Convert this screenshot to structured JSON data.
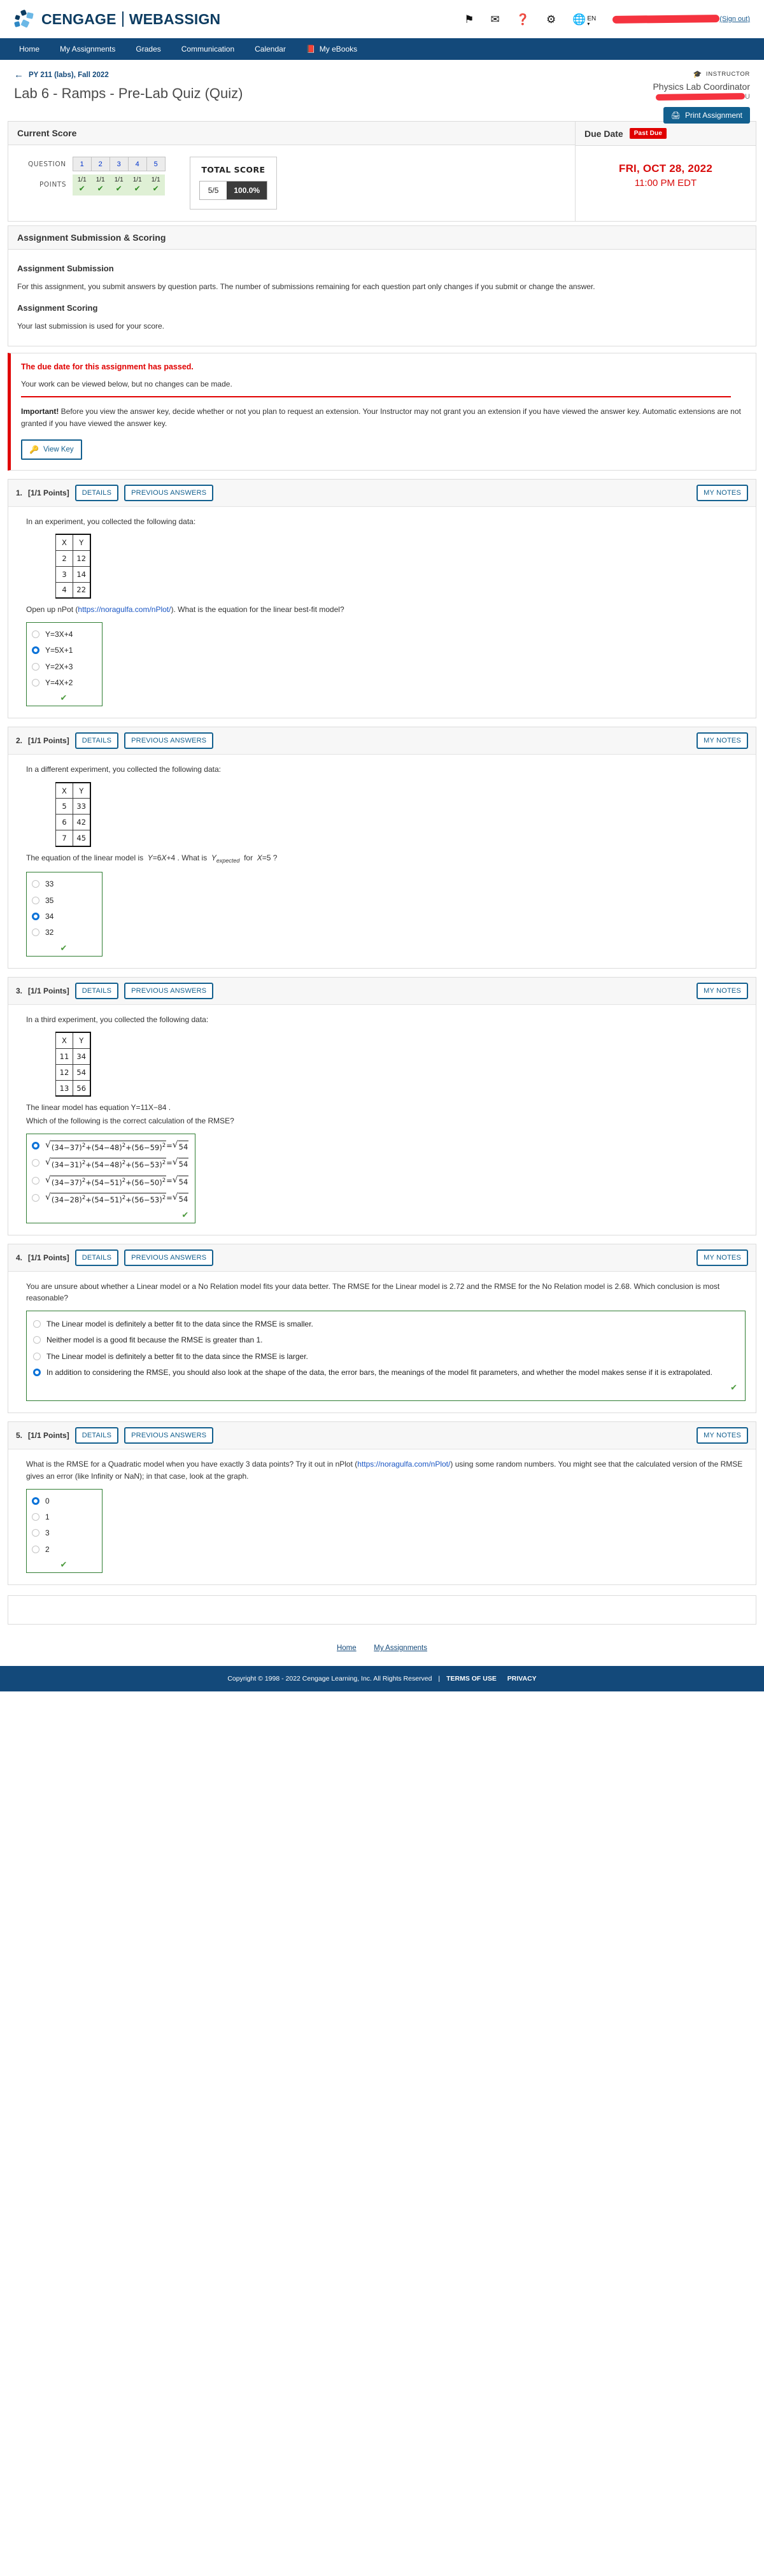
{
  "brand": {
    "name_left": "CENGAGE",
    "name_right": "WEBASSIGN"
  },
  "topbar": {
    "icons": [
      {
        "name": "flag-icon",
        "glyph": "⚑"
      },
      {
        "name": "mail-icon",
        "glyph": "✉"
      },
      {
        "name": "help-icon",
        "glyph": "❓"
      },
      {
        "name": "gear-icon",
        "glyph": "⚙"
      }
    ],
    "language": "EN",
    "signout": "(Sign out)"
  },
  "nav": {
    "items": [
      "Home",
      "My Assignments",
      "Grades",
      "Communication",
      "Calendar"
    ],
    "ebooks": "My eBooks"
  },
  "header": {
    "back_label": "PY 211 (labs), Fall 2022",
    "title": "Lab 6 - Ramps - Pre-Lab Quiz (Quiz)",
    "instructor_tag": "INSTRUCTOR",
    "instructor_name": "Physics Lab Coordinator",
    "instructor_email_suffix": "U",
    "print_button": "Print Assignment"
  },
  "score": {
    "panel_title": "Current Score",
    "question_row_label": "QUESTION",
    "points_row_label": "POINTS",
    "questions": [
      "1",
      "2",
      "3",
      "4",
      "5"
    ],
    "points": [
      "1/1",
      "1/1",
      "1/1",
      "1/1",
      "1/1"
    ],
    "total_label": "TOTAL SCORE",
    "total_fraction": "5/5",
    "total_percent": "100.0%"
  },
  "due": {
    "panel_title": "Due Date",
    "badge": "Past Due",
    "date": "FRI, OCT 28, 2022",
    "time": "11:00 PM EDT"
  },
  "submission": {
    "panel_title": "Assignment Submission & Scoring",
    "sub_heading": "Assignment Submission",
    "sub_text": "For this assignment, you submit answers by question parts. The number of submissions remaining for each question part only changes if you submit or change the answer.",
    "scoring_heading": "Assignment Scoring",
    "scoring_text": "Your last submission is used for your score."
  },
  "alert": {
    "title": "The due date for this assignment has passed.",
    "subtitle": "Your work can be viewed below, but no changes can be made.",
    "important_label": "Important!",
    "important_text": " Before you view the answer key, decide whether or not you plan to request an extension. Your Instructor may not grant you an extension if you have viewed the answer key. Automatic extensions are not granted if you have viewed the answer key.",
    "view_key_button": "View Key"
  },
  "question_buttons": {
    "details": "DETAILS",
    "previous": "PREVIOUS ANSWERS",
    "notes": "MY NOTES"
  },
  "questions": [
    {
      "number": "1.",
      "points": "[1/1 Points]",
      "intro": "In an experiment, you collected the following data:",
      "table": {
        "headers": [
          "X",
          "Y"
        ],
        "rows": [
          [
            "2",
            "12"
          ],
          [
            "3",
            "14"
          ],
          [
            "4",
            "22"
          ]
        ]
      },
      "prompt_pre": "Open up nPot (",
      "prompt_link": "https://noragulfa.com/nPlot/",
      "prompt_post": "). What is the equation for the linear best-fit model?",
      "options": [
        "Y=3X+4",
        "Y=5X+1",
        "Y=2X+3",
        "Y=4X+2"
      ],
      "selected": 1
    },
    {
      "number": "2.",
      "points": "[1/1 Points]",
      "intro": "In a different experiment, you collected the following data:",
      "table": {
        "headers": [
          "X",
          "Y"
        ],
        "rows": [
          [
            "5",
            "33"
          ],
          [
            "6",
            "42"
          ],
          [
            "7",
            "45"
          ]
        ]
      },
      "prompt_text": "The equation of the linear model is  Y=6X+4 . What is  Yexpected  for  X=5 ?",
      "options": [
        "33",
        "35",
        "34",
        "32"
      ],
      "selected": 2
    },
    {
      "number": "3.",
      "points": "[1/1 Points]",
      "intro": "In a third experiment, you collected the following data:",
      "table": {
        "headers": [
          "X",
          "Y"
        ],
        "rows": [
          [
            "11",
            "34"
          ],
          [
            "12",
            "54"
          ],
          [
            "13",
            "56"
          ]
        ]
      },
      "prompt_line1": "The linear model has equation  Y=11X−84 .",
      "prompt_line2": "Which of the following is the correct calculation of the RMSE?",
      "options": [
        "(34−37)²+(54−48)²+(56−59)² = √54",
        "(34−31)²+(54−48)²+(56−53)² = √54",
        "(34−37)²+(54−51)²+(56−50)² = √54",
        "(34−28)²+(54−51)²+(56−53)² = √54"
      ],
      "option_parts": [
        {
          "inner": "(34−37)",
          "e1": "2",
          "m1": "+(54−48)",
          "e2": "2",
          "m2": "+(56−59)",
          "e3": "2",
          "tail": "54"
        },
        {
          "inner": "(34−31)",
          "e1": "2",
          "m1": "+(54−48)",
          "e2": "2",
          "m2": "+(56−53)",
          "e3": "2",
          "tail": "54"
        },
        {
          "inner": "(34−37)",
          "e1": "2",
          "m1": "+(54−51)",
          "e2": "2",
          "m2": "+(56−50)",
          "e3": "2",
          "tail": "54"
        },
        {
          "inner": "(34−28)",
          "e1": "2",
          "m1": "+(54−51)",
          "e2": "2",
          "m2": "+(56−53)",
          "e3": "2",
          "tail": "54"
        }
      ],
      "selected": 0
    },
    {
      "number": "4.",
      "points": "[1/1 Points]",
      "prompt_text": "You are unsure about whether a Linear model or a No Relation model fits your data better. The RMSE for the Linear model is 2.72 and the RMSE for the No Relation model is 2.68. Which conclusion is most reasonable?",
      "options": [
        "The Linear model is definitely a better fit to the data since the RMSE is smaller.",
        "Neither model is a good fit because the RMSE is greater than 1.",
        "The Linear model is definitely a better fit to the data since the RMSE is larger.",
        "In addition to considering the RMSE, you should also look at the shape of the data, the error bars, the meanings of the model fit parameters, and whether the model makes sense if it is extrapolated."
      ],
      "selected": 3
    },
    {
      "number": "5.",
      "points": "[1/1 Points]",
      "prompt_pre": "What is the RMSE for a Quadratic model when you have exactly 3 data points? Try it out in nPlot (",
      "prompt_link": "https://noragulfa.com/nPlot/",
      "prompt_post": ") using some random numbers. You might see that the calculated version of the RMSE gives an error (like Infinity or NaN); in that case, look at the graph.",
      "options": [
        "0",
        "1",
        "3",
        "2"
      ],
      "selected": 0
    }
  ],
  "footer_links": [
    "Home",
    "My Assignments"
  ],
  "footer": {
    "copyright": "Copyright © 1998 - 2022 Cengage Learning, Inc. All Rights Reserved",
    "terms": "TERMS OF USE",
    "privacy": "PRIVACY"
  }
}
